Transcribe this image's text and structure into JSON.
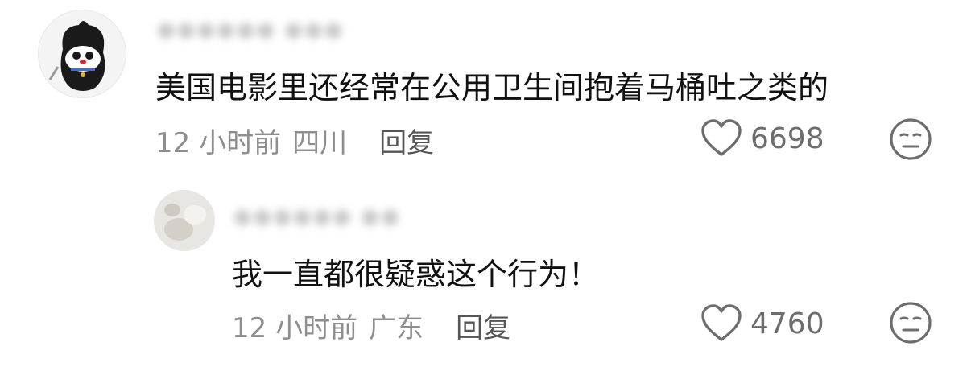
{
  "comments": [
    {
      "content": "美国电影里还经常在公用卫生间抱着马桶吐之类的",
      "time": "12 小时前",
      "location": "四川",
      "reply_label": "回复",
      "likes": "6698",
      "avatar_icon": "cartoon-cat-in-black-bag-avatar",
      "username_blurred": true
    },
    {
      "content": "我一直都很疑惑这个行为！",
      "time": "12 小时前",
      "location": "广东",
      "reply_label": "回复",
      "likes": "4760",
      "avatar_icon": "blurred-photo-avatar",
      "username_blurred": true
    }
  ],
  "icons": {
    "like": "heart-outline-icon",
    "dislike": "neutral-face-icon"
  },
  "colors": {
    "text": "#111111",
    "meta": "#8e8e8e",
    "icon": "#6d6d6d"
  }
}
